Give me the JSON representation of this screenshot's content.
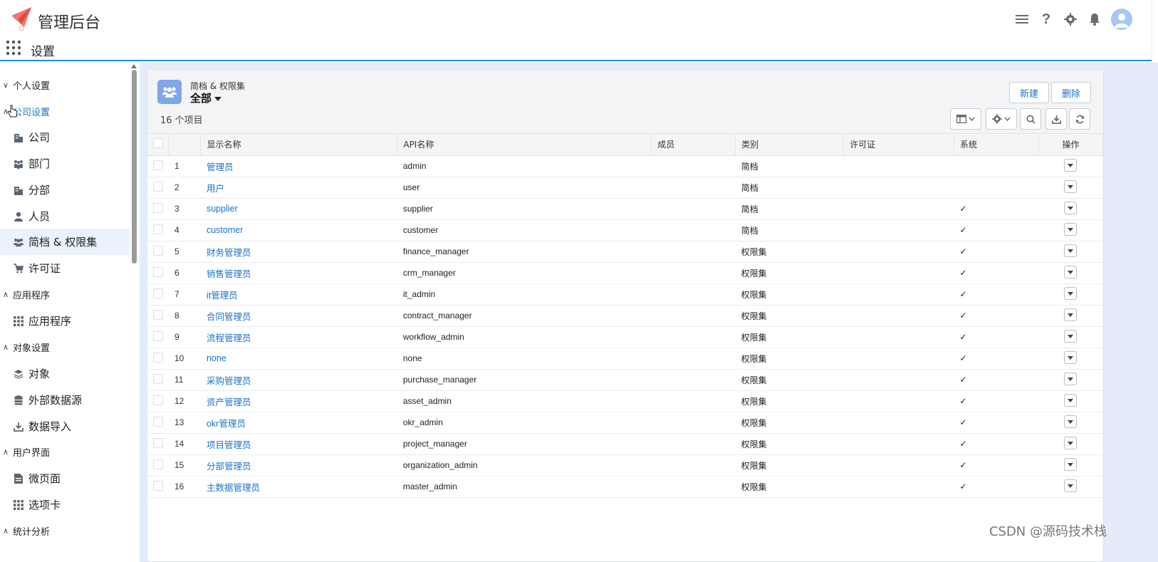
{
  "header": {
    "app_title": "管理后台",
    "section_title": "设置",
    "icons": [
      "menu-icon",
      "help-icon",
      "gear-icon",
      "bell-icon",
      "user-avatar"
    ]
  },
  "sidebar": {
    "groups": [
      {
        "label": "个人设置",
        "state": "collapsed"
      },
      {
        "label": "公司设置",
        "state": "expanded",
        "items": [
          {
            "label": "公司",
            "icon": "building-icon"
          },
          {
            "label": "部门",
            "icon": "people-icon"
          },
          {
            "label": "分部",
            "icon": "building-icon"
          },
          {
            "label": "人员",
            "icon": "person-icon"
          },
          {
            "label": "简档 & 权限集",
            "icon": "users-icon",
            "active": true
          },
          {
            "label": "许可证",
            "icon": "cart-icon"
          }
        ]
      },
      {
        "label": "应用程序",
        "state": "expanded",
        "items": [
          {
            "label": "应用程序",
            "icon": "grid-icon"
          }
        ]
      },
      {
        "label": "对象设置",
        "state": "expanded",
        "items": [
          {
            "label": "对象",
            "icon": "layers-icon"
          },
          {
            "label": "外部数据源",
            "icon": "database-icon"
          },
          {
            "label": "数据导入",
            "icon": "download-icon"
          }
        ]
      },
      {
        "label": "用户界面",
        "state": "expanded",
        "items": [
          {
            "label": "微页面",
            "icon": "page-icon"
          },
          {
            "label": "选项卡",
            "icon": "grid-icon"
          }
        ]
      },
      {
        "label": "统计分析",
        "state": "expanded"
      }
    ]
  },
  "list": {
    "object_label": "简档 & 权限集",
    "view_name": "全部",
    "count_text": "16 个项目",
    "new_button": "新建",
    "delete_button": "删除",
    "columns": [
      "显示名称",
      "API名称",
      "成员",
      "类别",
      "许可证",
      "系统",
      "操作"
    ],
    "rows": [
      {
        "no": "1",
        "name": "管理员",
        "api": "admin",
        "members": "",
        "category": "简档",
        "license": "",
        "system": ""
      },
      {
        "no": "2",
        "name": "用户",
        "api": "user",
        "members": "",
        "category": "简档",
        "license": "",
        "system": ""
      },
      {
        "no": "3",
        "name": "supplier",
        "api": "supplier",
        "members": "",
        "category": "简档",
        "license": "",
        "system": "✓"
      },
      {
        "no": "4",
        "name": "customer",
        "api": "customer",
        "members": "",
        "category": "简档",
        "license": "",
        "system": "✓"
      },
      {
        "no": "5",
        "name": "财务管理员",
        "api": "finance_manager",
        "members": "",
        "category": "权限集",
        "license": "",
        "system": "✓"
      },
      {
        "no": "6",
        "name": "销售管理员",
        "api": "crm_manager",
        "members": "",
        "category": "权限集",
        "license": "",
        "system": "✓"
      },
      {
        "no": "7",
        "name": "it管理员",
        "api": "it_admin",
        "members": "",
        "category": "权限集",
        "license": "",
        "system": "✓"
      },
      {
        "no": "8",
        "name": "合同管理员",
        "api": "contract_manager",
        "members": "",
        "category": "权限集",
        "license": "",
        "system": "✓"
      },
      {
        "no": "9",
        "name": "流程管理员",
        "api": "workflow_admin",
        "members": "",
        "category": "权限集",
        "license": "",
        "system": "✓"
      },
      {
        "no": "10",
        "name": "none",
        "api": "none",
        "members": "",
        "category": "权限集",
        "license": "",
        "system": "✓"
      },
      {
        "no": "11",
        "name": "采购管理员",
        "api": "purchase_manager",
        "members": "",
        "category": "权限集",
        "license": "",
        "system": "✓"
      },
      {
        "no": "12",
        "name": "资产管理员",
        "api": "asset_admin",
        "members": "",
        "category": "权限集",
        "license": "",
        "system": "✓"
      },
      {
        "no": "13",
        "name": "okr管理员",
        "api": "okr_admin",
        "members": "",
        "category": "权限集",
        "license": "",
        "system": "✓"
      },
      {
        "no": "14",
        "name": "项目管理员",
        "api": "project_manager",
        "members": "",
        "category": "权限集",
        "license": "",
        "system": "✓"
      },
      {
        "no": "15",
        "name": "分部管理员",
        "api": "organization_admin",
        "members": "",
        "category": "权限集",
        "license": "",
        "system": "✓"
      },
      {
        "no": "16",
        "name": "主数据管理员",
        "api": "master_admin",
        "members": "",
        "category": "权限集",
        "license": "",
        "system": "✓"
      }
    ]
  },
  "watermark": "CSDN @源码技术栈",
  "colors": {
    "accent": "#1b96e6",
    "link": "#1a73c7",
    "object_icon": "#7ea6e8",
    "main_bg": "#e3ecf8"
  }
}
